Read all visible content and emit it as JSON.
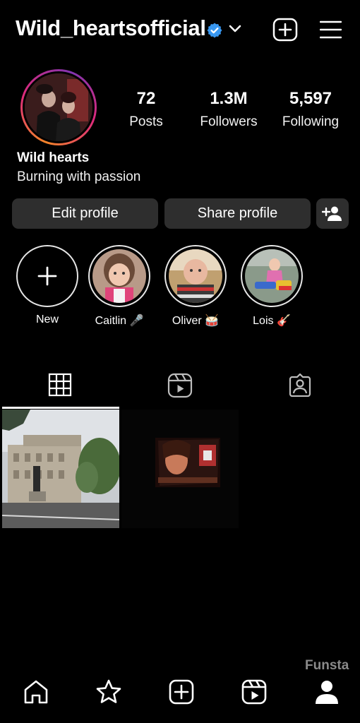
{
  "header": {
    "username": "Wild_heartsofficial"
  },
  "stats": [
    {
      "value": "72",
      "label": "Posts"
    },
    {
      "value": "1.3M",
      "label": "Followers"
    },
    {
      "value": "5,597",
      "label": "Following"
    }
  ],
  "profile": {
    "name": "Wild hearts",
    "bio": "Burning with passion"
  },
  "actions": {
    "edit_label": "Edit profile",
    "share_label": "Share profile"
  },
  "highlights": [
    {
      "label": "New"
    },
    {
      "label": "Caitlin 🎤"
    },
    {
      "label": "Oliver 🥁"
    },
    {
      "label": "Lois 🎸"
    }
  ],
  "watermark": "Funsta",
  "colors": {
    "background": "#000000",
    "button": "#2e2e2e",
    "verified": "#3897f0",
    "story_ring_start": "#f58529",
    "story_ring_end": "#dd2a7b"
  },
  "tabs": [
    {
      "icon": "grid-icon",
      "active": true
    },
    {
      "icon": "reels-icon",
      "active": false
    },
    {
      "icon": "tagged-icon",
      "active": false
    }
  ],
  "nav": [
    {
      "icon": "home-icon"
    },
    {
      "icon": "star-icon"
    },
    {
      "icon": "create-icon"
    },
    {
      "icon": "reels-icon"
    },
    {
      "icon": "profile-icon"
    }
  ]
}
